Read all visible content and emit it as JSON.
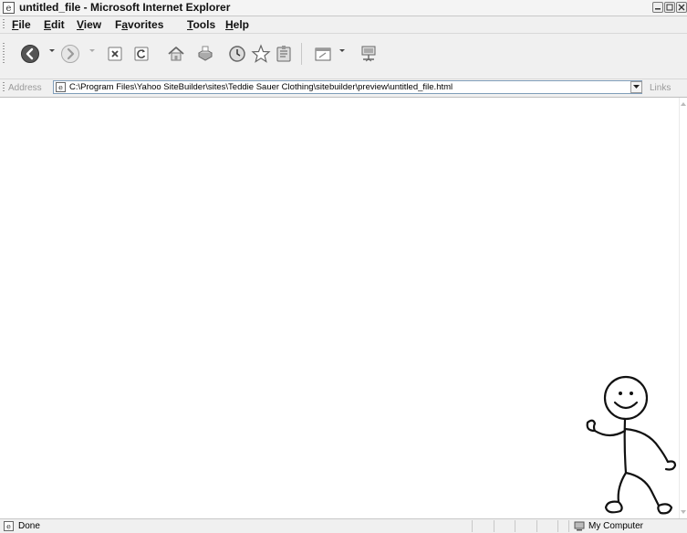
{
  "window": {
    "title": "untitled_file - Microsoft Internet Explorer"
  },
  "menubar": {
    "items": [
      {
        "first": "F",
        "rest": "ile"
      },
      {
        "first": "E",
        "rest": "dit"
      },
      {
        "first": "V",
        "rest": "iew"
      },
      {
        "pre": "F",
        "first": "a",
        "rest": "vorites"
      },
      {
        "first": "T",
        "rest": "ools"
      },
      {
        "first": "H",
        "rest": "elp"
      }
    ]
  },
  "toolbar": {
    "buttons": [
      "back-icon",
      "forward-icon",
      "stop-icon",
      "refresh-icon",
      "home-icon",
      "print-icon",
      "history-icon",
      "favorites-icon",
      "research-icon",
      "edit-icon",
      "network-icon"
    ]
  },
  "address": {
    "label": "Address",
    "value": "C:\\Program Files\\Yahoo SiteBuilder\\sites\\Teddie Sauer Clothing\\sitebuilder\\preview\\untitled_file.html",
    "links_label": "Links"
  },
  "status": {
    "text": "Done",
    "zone": "My Computer"
  },
  "colors": {
    "chrome": "#f0f0f0",
    "address_border": "#7f9db9"
  }
}
